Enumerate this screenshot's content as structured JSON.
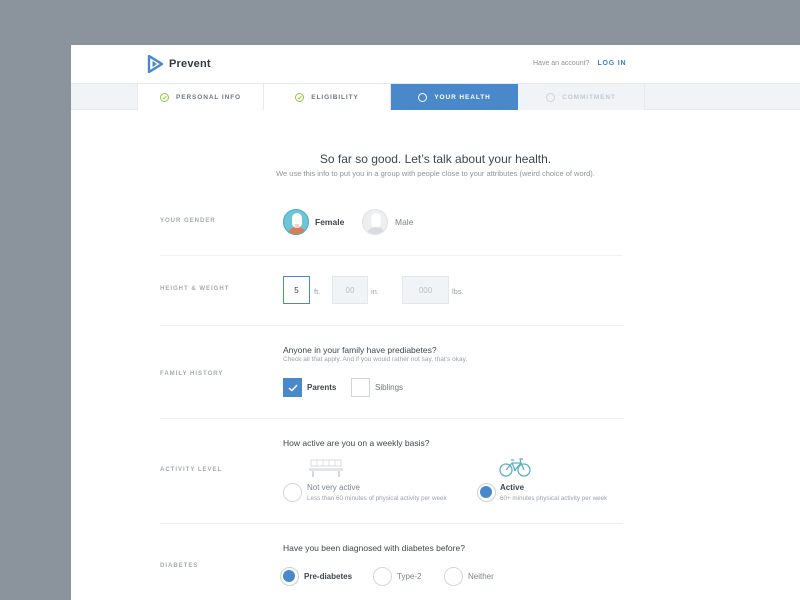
{
  "header": {
    "brand": "Prevent",
    "account_prompt": "Have an account?",
    "login_label": "LOG IN"
  },
  "steps": [
    {
      "label": "PERSONAL INFO",
      "state": "done"
    },
    {
      "label": "ELIGIBILITY",
      "state": "done"
    },
    {
      "label": "YOUR HEALTH",
      "state": "current"
    },
    {
      "label": "COMMITMENT",
      "state": "upcoming"
    }
  ],
  "intro": {
    "title": "So far so good. Let’s talk about your health.",
    "subtitle": "We use this info to put you in a group with people close to your attributes (weird choice of word)."
  },
  "gender": {
    "label": "YOUR GENDER",
    "options": [
      {
        "label": "Female",
        "selected": true
      },
      {
        "label": "Male",
        "selected": false
      }
    ]
  },
  "height_weight": {
    "label": "HEIGHT & WEIGHT",
    "feet_value": "5",
    "feet_unit": "ft.",
    "inches_placeholder": "00",
    "inches_unit": "in.",
    "weight_placeholder": "000",
    "weight_unit": "lbs."
  },
  "family_history": {
    "label": "FAMILY HISTORY",
    "question": "Anyone in your family have prediabetes?",
    "hint": "Check all that apply. And if you would rather not say, that’s okay.",
    "options": [
      {
        "label": "Parents",
        "checked": true
      },
      {
        "label": "Siblings",
        "checked": false
      }
    ]
  },
  "activity": {
    "label": "ACTIVITY LEVEL",
    "question": "How active are you on a weekly basis?",
    "options": [
      {
        "label": "Not very active",
        "desc": "Less than 60 minutes of physical activity per week",
        "icon": "bench-icon",
        "selected": false
      },
      {
        "label": "Active",
        "desc": "60+ minutes physical activity per week",
        "icon": "bicycle-icon",
        "selected": true
      }
    ]
  },
  "diabetes": {
    "label": "DIABETES",
    "question": "Have you been diagnosed with diabetes before?",
    "options": [
      {
        "label": "Pre-diabetes",
        "selected": true
      },
      {
        "label": "Type-2",
        "selected": false
      },
      {
        "label": "Neither",
        "selected": false
      }
    ]
  },
  "colors": {
    "accent": "#4a88cc",
    "check": "#9cc33f",
    "background": "#8b939c"
  }
}
